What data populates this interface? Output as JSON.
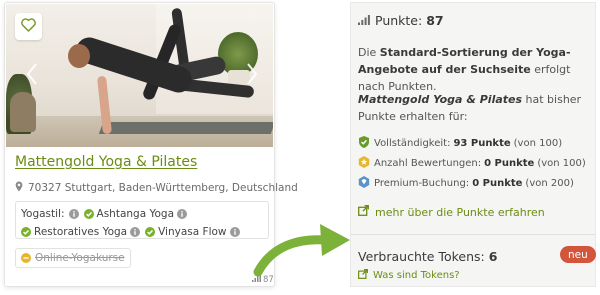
{
  "studio_card": {
    "name": "Mattengold Yoga & Pilates",
    "address": "70327 Stuttgart, Baden-Württemberg, Deutschland",
    "yogastil_label": "Yogastil:",
    "styles": [
      "Ashtanga Yoga",
      "Restoratives Yoga",
      "Vinyasa Flow"
    ],
    "online_label": "Online-Yogakurse",
    "score": "87",
    "icons": {
      "favorite": "heart-icon",
      "prev": "chevron-left-icon",
      "next": "chevron-right-icon",
      "location": "map-pin-icon",
      "info": "info-icon",
      "check": "check-icon",
      "cross": "minus-circle-icon",
      "score": "signal-bars-icon"
    }
  },
  "points_panel": {
    "points_label": "Punkte:",
    "points_value": "87",
    "intro": {
      "pre": "Die ",
      "bold": "Standard-Sortierung der Yoga-Angebote auf der Suchseite",
      "post": " erfolgt nach Punkten."
    },
    "earned": {
      "studio": "Mattengold Yoga & Pilates",
      "text": " hat bisher Punkte erhalten für:"
    },
    "criteria": [
      {
        "label": "Vollständigkeit:",
        "points": "93 Punkte",
        "max": "(von 100)",
        "icon": "shield-check-icon",
        "color": "#6b9a2c"
      },
      {
        "label": "Anzahl Bewertungen:",
        "points": "0 Punkte",
        "max": "(von 100)",
        "icon": "star-badge-icon",
        "color": "#e8b52c"
      },
      {
        "label": "Premium-Buchung:",
        "points": "0 Punkte",
        "max": "(von 200)",
        "icon": "diamond-badge-icon",
        "color": "#5a93c7"
      }
    ],
    "more_link": "mehr über die Punkte erfahren",
    "tokens_label": "Verbrauchte Tokens:",
    "tokens_value": "6",
    "new_badge": "neu",
    "tokens_link": "Was sind Tokens?"
  },
  "colors": {
    "brand_green": "#6b8c12",
    "check_green": "#79b12a",
    "badge_red": "#d2553c",
    "arrow_green": "#7cb23a"
  }
}
